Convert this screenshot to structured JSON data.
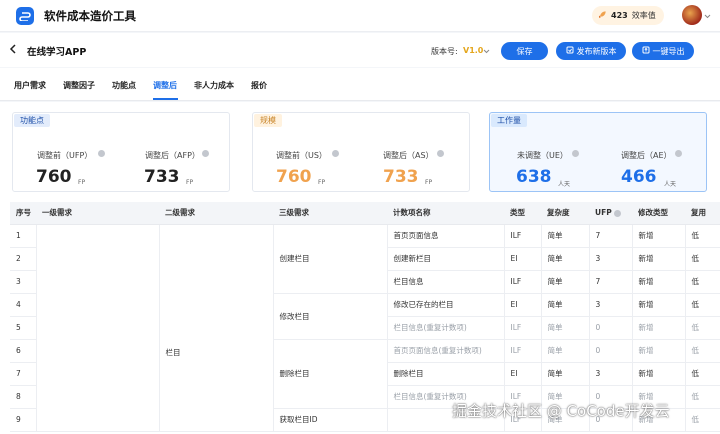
{
  "app": {
    "title": "软件成本造价工具",
    "score_value": "423",
    "score_label": "效率值"
  },
  "header": {
    "project_name": "在线学习APP",
    "version_label": "版本号:",
    "version_value": "V1.0",
    "save_label": "保存",
    "publish_label": "发布新版本",
    "export_label": "一键导出"
  },
  "tabs": [
    {
      "label": "用户需求"
    },
    {
      "label": "调整因子"
    },
    {
      "label": "功能点"
    },
    {
      "label": "调整后"
    },
    {
      "label": "非人力成本"
    },
    {
      "label": "报价"
    }
  ],
  "active_tab": "调整后",
  "cards": [
    {
      "tag": "功能点",
      "left": {
        "label": "调整前（UFP）",
        "value": "760",
        "unit": "FP"
      },
      "right": {
        "label": "调整后（AFP）",
        "value": "733",
        "unit": "FP"
      }
    },
    {
      "tag": "规模",
      "left": {
        "label": "调整前（US）",
        "value": "760",
        "unit": "FP"
      },
      "right": {
        "label": "调整后（AS）",
        "value": "733",
        "unit": "FP"
      }
    },
    {
      "tag": "工作量",
      "left": {
        "label": "未调整（UE）",
        "value": "638",
        "unit": "人天"
      },
      "right": {
        "label": "调整后（AE）",
        "value": "466",
        "unit": "人天"
      }
    }
  ],
  "table": {
    "headers": [
      "序号",
      "一级需求",
      "二级需求",
      "三级需求",
      "计数项名称",
      "类型",
      "复杂度",
      "UFP",
      "修改类型",
      "复用"
    ],
    "level2_value": "栏目",
    "level3_groups": [
      "创建栏目",
      "修改栏目",
      "删除栏目",
      "获取栏目ID"
    ],
    "rows": [
      {
        "seq": "1",
        "name": "首页页面信息",
        "type": "ILF",
        "complexity": "简单",
        "ufp": "7",
        "modify": "新增",
        "reuse": "低",
        "muted": false
      },
      {
        "seq": "2",
        "name": "创建新栏目",
        "type": "EI",
        "complexity": "简单",
        "ufp": "3",
        "modify": "新增",
        "reuse": "低",
        "muted": false
      },
      {
        "seq": "3",
        "name": "栏目信息",
        "type": "ILF",
        "complexity": "简单",
        "ufp": "7",
        "modify": "新增",
        "reuse": "低",
        "muted": false
      },
      {
        "seq": "4",
        "name": "修改已存在的栏目",
        "type": "EI",
        "complexity": "简单",
        "ufp": "3",
        "modify": "新增",
        "reuse": "低",
        "muted": false
      },
      {
        "seq": "5",
        "name": "栏目信息(重复计数项)",
        "type": "ILF",
        "complexity": "简单",
        "ufp": "0",
        "modify": "新增",
        "reuse": "低",
        "muted": true
      },
      {
        "seq": "6",
        "name": "首页页面信息(重复计数项)",
        "type": "ILF",
        "complexity": "简单",
        "ufp": "0",
        "modify": "新增",
        "reuse": "低",
        "muted": true
      },
      {
        "seq": "7",
        "name": "删除栏目",
        "type": "EI",
        "complexity": "简单",
        "ufp": "3",
        "modify": "新增",
        "reuse": "低",
        "muted": false
      },
      {
        "seq": "8",
        "name": "栏目信息(重复计数项)",
        "type": "ILF",
        "complexity": "简单",
        "ufp": "0",
        "modify": "新增",
        "reuse": "低",
        "muted": true
      },
      {
        "seq": "9",
        "name": "",
        "type": "ILF",
        "complexity": "简单",
        "ufp": "0",
        "modify": "新增",
        "reuse": "低",
        "muted": true
      }
    ]
  },
  "watermark": "掘金技术社区 @ CoCode开发云",
  "colors": {
    "accent": "#1e6fe8",
    "orange": "#f0a24e",
    "version": "#e4a61c"
  },
  "icons": [
    "logo-icon",
    "rocket-icon",
    "chevron-down-icon",
    "back-arrow-icon",
    "publish-icon",
    "export-icon",
    "info-icon"
  ]
}
